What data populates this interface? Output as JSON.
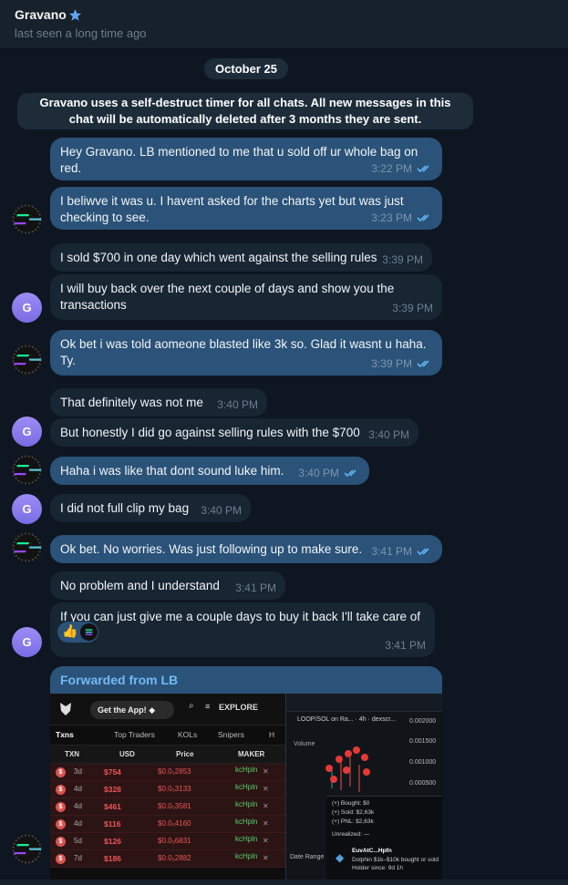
{
  "header": {
    "name": "Gravano",
    "status": "last seen a long time ago"
  },
  "chat": {
    "date": "October 25",
    "service_notice": "Gravano uses a self-destruct timer for all chats. All new messages in this chat will be automatically deleted after 3 months they are sent.",
    "messages": [
      {
        "dir": "out",
        "text": "Hey Gravano. LB mentioned to me that u sold off ur whole bag on red.",
        "time": "3:22 PM"
      },
      {
        "dir": "out",
        "text": "I beliwve it was u. I havent asked for the charts yet but was just checking to see.",
        "time": "3:23 PM"
      },
      {
        "dir": "in",
        "text": "I sold $700 in one day which went against the selling rules",
        "time": "3:39 PM"
      },
      {
        "dir": "in",
        "text": "I will buy back over the next couple of days and show you the transactions",
        "time": "3:39 PM"
      },
      {
        "dir": "out",
        "text": "Ok bet  i was told aomeone blasted like 3k so. Glad it wasnt u haha. Ty.",
        "time": "3:39 PM"
      },
      {
        "dir": "in",
        "text": "That definitely was not me",
        "time": "3:40 PM"
      },
      {
        "dir": "in",
        "text": "But honestly I did go against selling rules with the $700",
        "time": "3:40 PM"
      },
      {
        "dir": "out",
        "text": "Haha i was like that dont sound luke him.",
        "time": "3:40 PM"
      },
      {
        "dir": "in",
        "text": "I did not full clip my bag",
        "time": "3:40 PM"
      },
      {
        "dir": "out",
        "text": "Ok bet. No worries. Was just following up to make sure.",
        "time": "3:41 PM"
      },
      {
        "dir": "in",
        "text": "No problem and I understand",
        "time": "3:41 PM"
      },
      {
        "dir": "in",
        "text": "If you can just give me a couple days to buy it back I'll take care of it",
        "time": "3:41 PM"
      }
    ],
    "avatar_letter": "G",
    "reaction_emoji": "👍",
    "forwarded_label": "Forwarded from LB"
  },
  "screenshot": {
    "get_app": "Get the App!",
    "explore": "EXPLORE",
    "tabs": [
      "Txns",
      "Top Traders",
      "KOLs",
      "Snipers",
      "H"
    ],
    "columns": [
      "TXN",
      "USD",
      "Price",
      "MAKER"
    ],
    "rows": [
      {
        "age": "3d",
        "usd": "$754",
        "price": "$0.0₅2853",
        "maker": "kcHpln"
      },
      {
        "age": "4d",
        "usd": "$328",
        "price": "$0.0₅3133",
        "maker": "kcHpln"
      },
      {
        "age": "4d",
        "usd": "$461",
        "price": "$0.0₅3581",
        "maker": "kcHpln"
      },
      {
        "age": "4d",
        "usd": "$116",
        "price": "$0.0₅4160",
        "maker": "kcHpln"
      },
      {
        "age": "5d",
        "usd": "$126",
        "price": "$0.0₅6831",
        "maker": "kcHpln"
      },
      {
        "age": "7d",
        "usd": "$186",
        "price": "$0.0₅2882",
        "maker": "kcHpln"
      }
    ],
    "chart_title": "LOOP/SOL on Ra... · 4h · dexscr...",
    "axis_labels": [
      "0.002000",
      "0.001500",
      "0.001000",
      "0.000500"
    ],
    "volume": "Volume",
    "bought": "(+) Bought: $0",
    "sold": "(+) Sold: $2,63k",
    "pnl": "(+) PNL: $2,63k",
    "unrealized": "Unrealized: —",
    "wallet": "EuvAtC...Hpfn",
    "wallet_desc": "Dolphin $1k–$10k bought or sold",
    "holder": "Holder since: 9d 1h",
    "date_range": "Date Range"
  }
}
